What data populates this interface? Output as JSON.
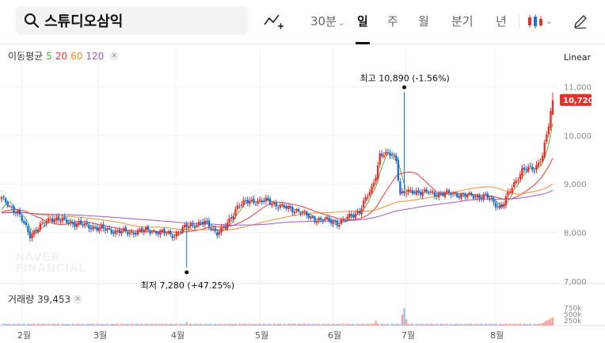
{
  "search": {
    "stock_name": "스튜디오삼익"
  },
  "toolbar": {
    "icons": [
      "search-icon",
      "indicator-add-icon",
      "candlestick-icon",
      "chevron-down-icon",
      "pencil-icon"
    ],
    "intraday_label": "30분",
    "periods": [
      "일",
      "주",
      "월",
      "분기",
      "년"
    ],
    "active_period": "일"
  },
  "ma_legend": {
    "label": "이동평균",
    "p5": "5",
    "p20": "20",
    "p60": "60",
    "p120": "120"
  },
  "scale_mode": "Linear",
  "volume_legend": {
    "label": "거래량",
    "value": "39,453"
  },
  "watermark": {
    "line1": "NAVER",
    "line2": "FINANCIAL"
  },
  "colors": {
    "up": "#e5312b",
    "down": "#1b6fd6",
    "ma5": "#5ab03b",
    "ma20": "#e53935",
    "ma60": "#f08c2a",
    "ma120": "#9a58c8",
    "current_price_bg": "#e5312b"
  },
  "chart_data": {
    "type": "candlestick",
    "y_ticks": [
      "11,000",
      "10,000",
      "9,000",
      "8,000",
      "7,000"
    ],
    "y_tick_values": [
      11000,
      10000,
      9000,
      8000,
      7000
    ],
    "x_ticks": [
      "2월",
      "3월",
      "4월",
      "5월",
      "6월",
      "7월",
      "8월"
    ],
    "current_price": "10,720",
    "current_price_value": 10720,
    "high_annotation": "최고 10,890 (-1.56%)",
    "high_value": 10890,
    "low_annotation": "최저 7,280 (+47.25%)",
    "low_value": 7280,
    "volume_ticks": [
      "750k",
      "500k",
      "250k"
    ],
    "legend": [
      "5",
      "20",
      "60",
      "120"
    ]
  }
}
